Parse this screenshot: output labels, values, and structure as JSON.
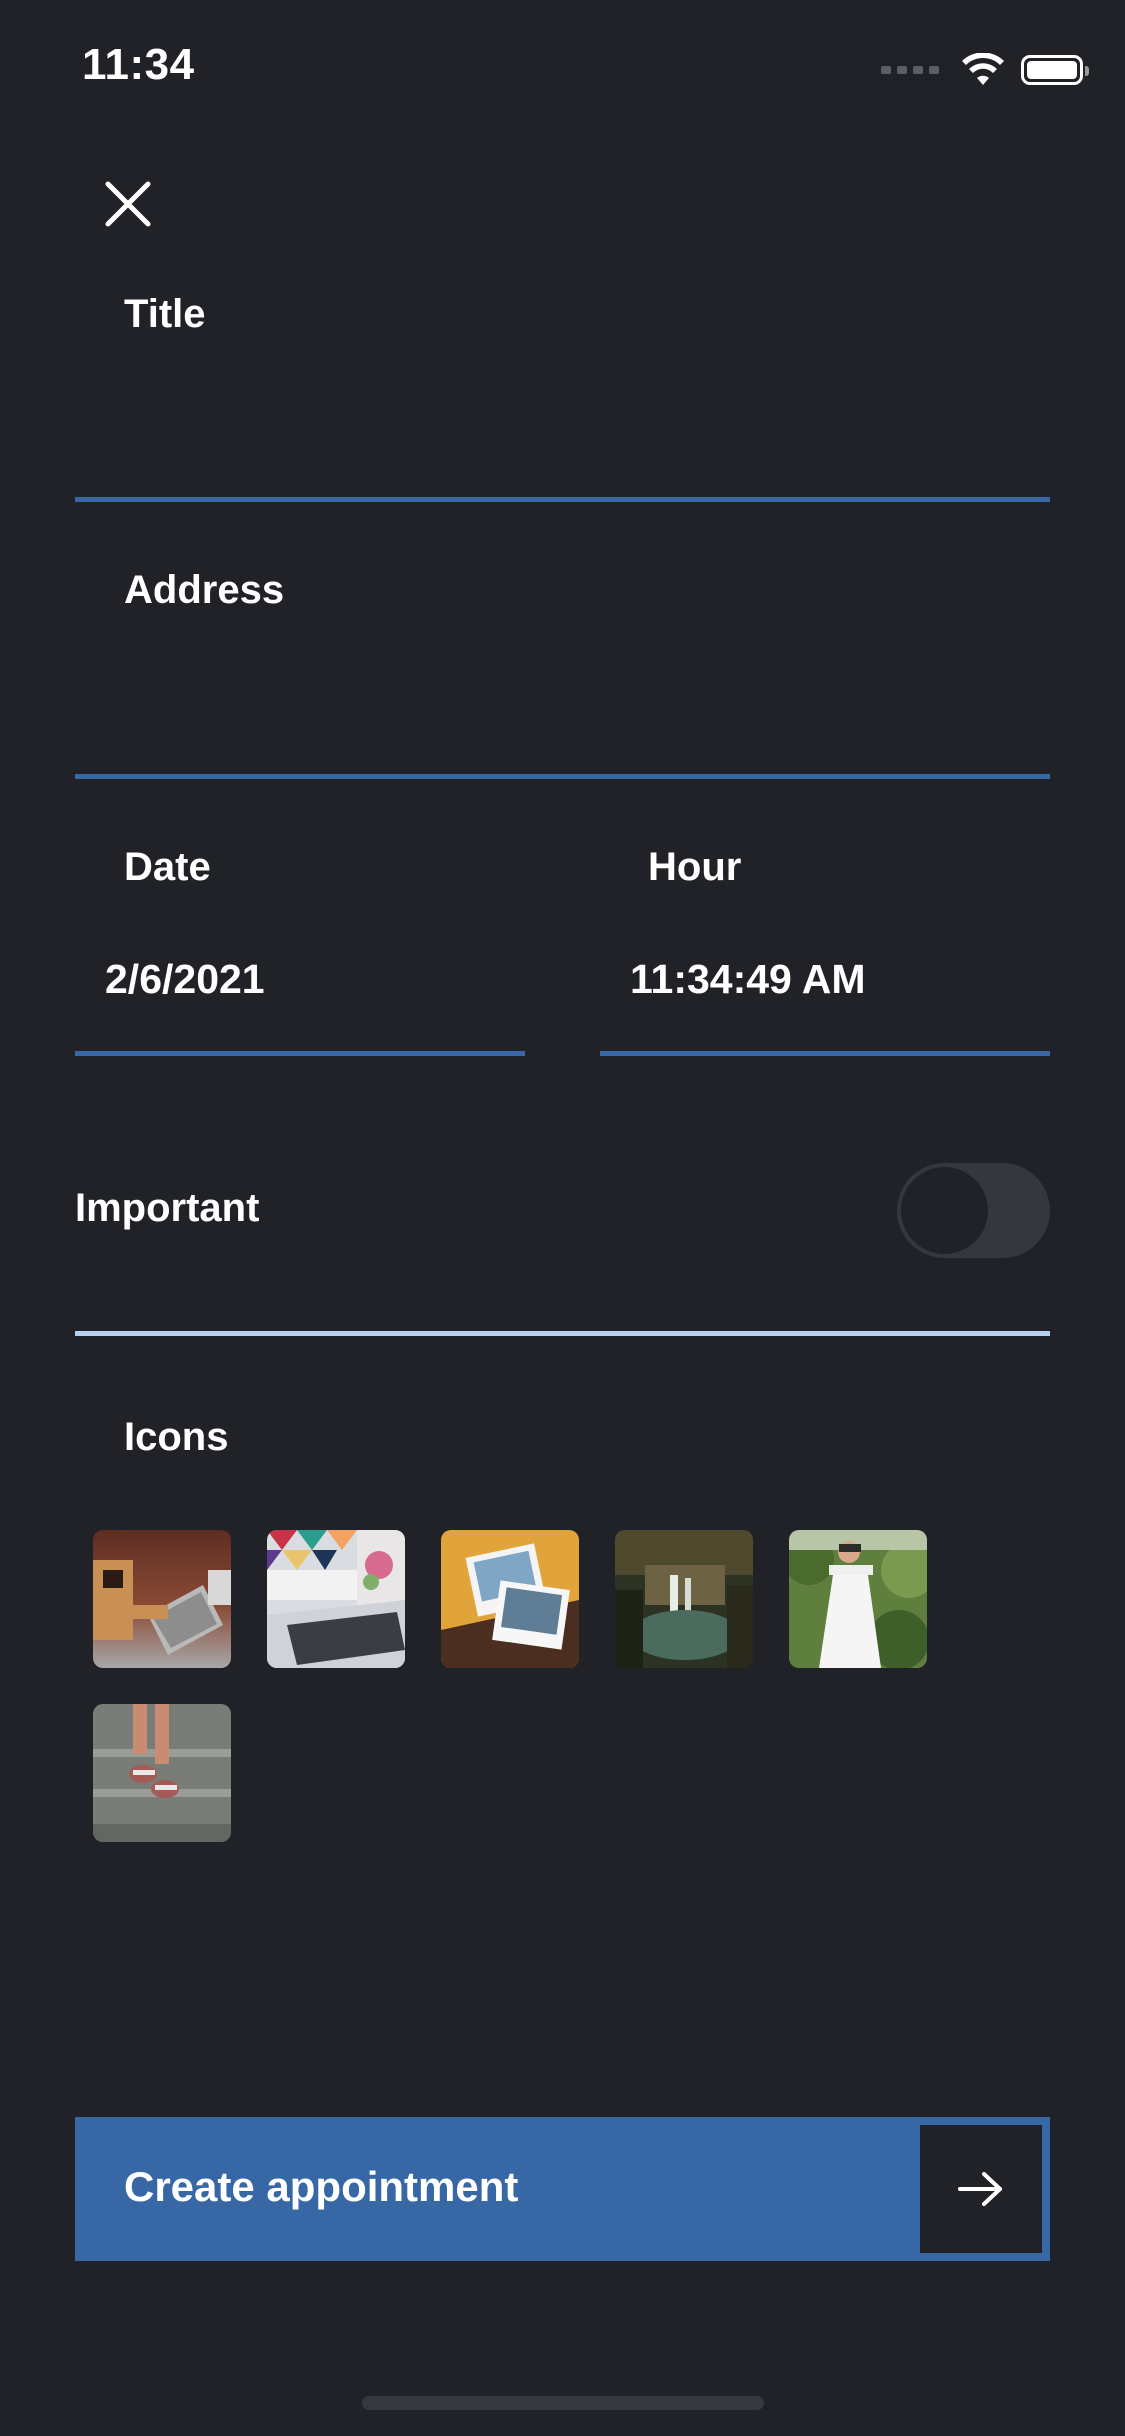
{
  "status_bar": {
    "time": "11:34",
    "wifi_icon": "wifi-icon",
    "battery_icon": "battery-icon"
  },
  "close_icon": "close-icon",
  "form": {
    "title_label": "Title",
    "title_value": "",
    "address_label": "Address",
    "address_value": "",
    "date_label": "Date",
    "date_value": "2/6/2021",
    "hour_label": "Hour",
    "hour_value": "11:34:49 AM",
    "important_label": "Important",
    "important_on": false,
    "icons_label": "Icons",
    "icons": [
      {
        "name": "robot-laptop-thumbnail"
      },
      {
        "name": "laptop-colorful-thumbnail"
      },
      {
        "name": "photos-stack-thumbnail"
      },
      {
        "name": "waterfall-thumbnail"
      },
      {
        "name": "woman-white-dress-thumbnail"
      },
      {
        "name": "stairs-feet-thumbnail"
      }
    ]
  },
  "create_button": {
    "label": "Create appointment",
    "arrow_icon": "arrow-right-icon"
  },
  "colors": {
    "background": "#202227",
    "accent": "#3867a6",
    "divider_light": "#b6d0ef",
    "toggle_track": "#34373e"
  }
}
